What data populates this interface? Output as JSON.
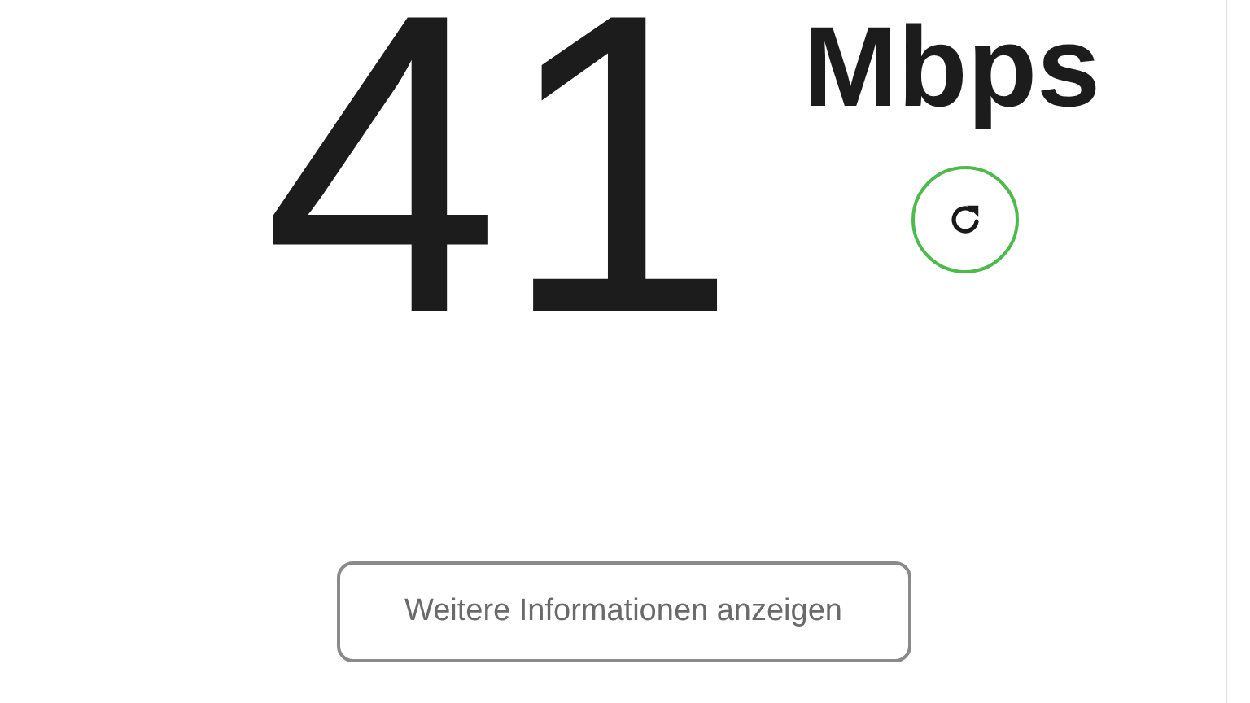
{
  "speed": {
    "value": "41",
    "unit": "Mbps"
  },
  "more_info_button": {
    "label": "Weitere Informationen anzeigen"
  }
}
